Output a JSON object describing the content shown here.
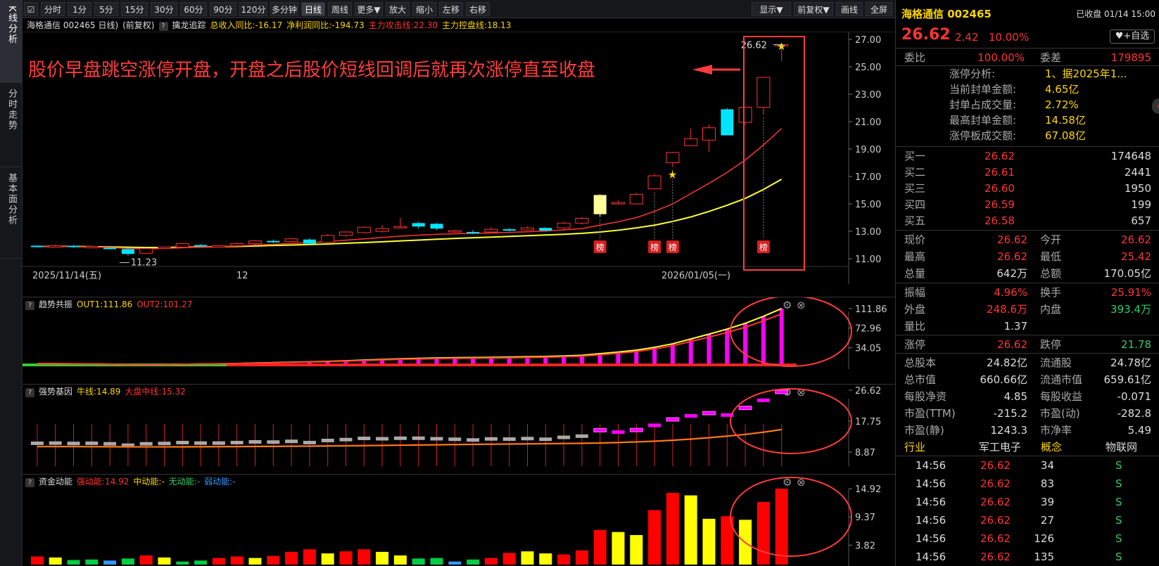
{
  "vtabs": [
    "K线分析",
    "分时走势",
    "基本面分析"
  ],
  "toolbar": {
    "items": [
      "分时",
      "1分",
      "5分",
      "15分",
      "30分",
      "60分",
      "90分",
      "120分",
      "多分钟",
      "日线",
      "周线",
      "更多▼",
      "放大",
      "缩小",
      "左移",
      "右移"
    ],
    "right": [
      "显示▼",
      "前复权▼",
      "画线",
      "全屏"
    ],
    "active": "日线"
  },
  "info": {
    "name": "海格通信 002465 日线)",
    "fq": "(前复权)",
    "q": "?",
    "indicator": "擒龙追踪",
    "rev": "总收入同比:-16.17",
    "profit": "净利润同比:-194.73",
    "attack": "主力攻击线:22.30",
    "control": "主力控盘线:18.13"
  },
  "annotation": "股价早盘跳空涨停开盘，开盘之后股价短线回调后就再次涨停直至收盘",
  "main_chart": {
    "y_ticks": [
      "27.00",
      "25.00",
      "23.00",
      "21.00",
      "19.00",
      "17.00",
      "15.00",
      "13.00",
      "11.00"
    ],
    "dates": [
      "2025/11/14(五)",
      "12",
      "2026/01/05(一)"
    ],
    "low_label": "11.23",
    "high_label": "26.62",
    "bang": "榜",
    "candles": [
      [
        11.95,
        11.9,
        12.0,
        11.85
      ],
      [
        11.92,
        11.95,
        12.05,
        11.85
      ],
      [
        11.95,
        11.85,
        12.0,
        11.8
      ],
      [
        11.9,
        11.9,
        11.95,
        11.8
      ],
      [
        11.8,
        11.75,
        11.85,
        11.7
      ],
      [
        11.7,
        11.35,
        11.75,
        11.23
      ],
      [
        11.4,
        11.75,
        11.8,
        11.35
      ],
      [
        11.75,
        11.85,
        11.9,
        11.7
      ],
      [
        11.85,
        12.1,
        12.15,
        11.8
      ],
      [
        12.0,
        11.95,
        12.05,
        11.9
      ],
      [
        11.9,
        11.95,
        12.0,
        11.85
      ],
      [
        11.95,
        12.1,
        12.2,
        11.9
      ],
      [
        12.1,
        12.3,
        12.35,
        12.0
      ],
      [
        12.3,
        12.25,
        12.4,
        12.15
      ],
      [
        12.25,
        12.45,
        12.5,
        12.2
      ],
      [
        12.4,
        12.1,
        12.5,
        12.05
      ],
      [
        12.2,
        12.7,
        12.8,
        12.15
      ],
      [
        12.7,
        12.95,
        13.0,
        12.6
      ],
      [
        12.9,
        13.3,
        13.35,
        12.85
      ],
      [
        13.0,
        13.2,
        13.45,
        12.9
      ],
      [
        13.3,
        13.35,
        14.0,
        13.2
      ],
      [
        13.6,
        13.35,
        13.7,
        13.2
      ],
      [
        13.55,
        13.2,
        13.6,
        13.1
      ],
      [
        13.0,
        13.05,
        13.1,
        12.9
      ],
      [
        12.95,
        12.85,
        13.1,
        12.8
      ],
      [
        12.95,
        13.15,
        13.3,
        12.9
      ],
      [
        13.15,
        13.1,
        13.25,
        13.0
      ],
      [
        13.1,
        13.25,
        13.35,
        13.05
      ],
      [
        13.25,
        13.05,
        13.3,
        13.0
      ],
      [
        13.25,
        13.6,
        13.7,
        13.15
      ],
      [
        13.6,
        13.95,
        14.05,
        13.5
      ],
      [
        14.25,
        15.65,
        15.7,
        14.05
      ],
      [
        15.1,
        15.1,
        15.25,
        14.95
      ],
      [
        15.0,
        15.7,
        15.8,
        14.95
      ],
      [
        16.1,
        17.05,
        17.2,
        16.05
      ],
      [
        18.0,
        18.75,
        18.8,
        17.7
      ],
      [
        19.25,
        19.75,
        20.5,
        19.2
      ],
      [
        19.65,
        20.55,
        20.8,
        18.8
      ],
      [
        21.9,
        20.0,
        22.0,
        20.0
      ],
      [
        20.95,
        22.05,
        22.1,
        20.75
      ],
      [
        22.05,
        24.23,
        24.23,
        21.5
      ],
      [
        26.62,
        26.62,
        26.62,
        25.42
      ]
    ],
    "ma_red": [
      11.9,
      11.9,
      11.88,
      11.86,
      11.82,
      11.75,
      11.72,
      11.75,
      11.8,
      11.85,
      11.88,
      11.92,
      12.0,
      12.05,
      12.12,
      12.18,
      12.25,
      12.35,
      12.45,
      12.55,
      12.65,
      12.72,
      12.78,
      12.82,
      12.85,
      12.88,
      12.92,
      12.97,
      13.02,
      13.1,
      13.2,
      13.45,
      13.7,
      14.0,
      14.45,
      15.0,
      15.75,
      16.5,
      17.3,
      18.2,
      19.3,
      20.5
    ],
    "ma_yellow": [
      11.9,
      11.9,
      11.9,
      11.88,
      11.86,
      11.84,
      11.82,
      11.82,
      11.84,
      11.86,
      11.88,
      11.9,
      11.93,
      11.97,
      12.0,
      12.04,
      12.08,
      12.13,
      12.18,
      12.24,
      12.3,
      12.36,
      12.42,
      12.48,
      12.53,
      12.58,
      12.63,
      12.68,
      12.73,
      12.78,
      12.85,
      12.95,
      13.08,
      13.25,
      13.45,
      13.72,
      14.05,
      14.45,
      14.9,
      15.4,
      16.05,
      16.8
    ],
    "bang_at": [
      31,
      34,
      35,
      40
    ]
  },
  "sub1": {
    "title": "趋势共振",
    "out1": "OUT1:111.86",
    "out2": "OUT2:101.27",
    "y_ticks": [
      "111.86",
      "72.96",
      "34.05"
    ]
  },
  "sub2": {
    "title": "强势基因",
    "bull": "牛线:14.89",
    "market": "大盘中线:15.32",
    "y_ticks": [
      "26.62",
      "17.75",
      "8.87"
    ]
  },
  "sub3": {
    "title": "资金动能",
    "strong": "强动能:14.92",
    "mid": "中动能:-",
    "none": "无动能:-",
    "weak": "弱动能:-",
    "y_ticks": [
      "14.92",
      "9.37",
      "3.82"
    ],
    "bars": [
      [
        1.6,
        "#ff0000"
      ],
      [
        1.4,
        "#ffff00"
      ],
      [
        0.9,
        "#00cc44"
      ],
      [
        1.0,
        "#00cc44"
      ],
      [
        0.8,
        "#3399ff"
      ],
      [
        1.2,
        "#00cc44"
      ],
      [
        1.8,
        "#ff0000"
      ],
      [
        1.4,
        "#ffff00"
      ],
      [
        0.6,
        "#00cc44"
      ],
      [
        0.8,
        "#00cc44"
      ],
      [
        1.3,
        "#ff0000"
      ],
      [
        1.6,
        "#ff0000"
      ],
      [
        1.3,
        "#ffff00"
      ],
      [
        1.7,
        "#ff0000"
      ],
      [
        2.5,
        "#ff0000"
      ],
      [
        3.0,
        "#ff0000"
      ],
      [
        2.2,
        "#ffff00"
      ],
      [
        2.6,
        "#ff0000"
      ],
      [
        3.0,
        "#ff0000"
      ],
      [
        2.5,
        "#ffff00"
      ],
      [
        1.8,
        "#ffff00"
      ],
      [
        1.2,
        "#00cc44"
      ],
      [
        1.3,
        "#00cc44"
      ],
      [
        0.6,
        "#3399ff"
      ],
      [
        1.0,
        "#00cc44"
      ],
      [
        1.3,
        "#ff0000"
      ],
      [
        2.3,
        "#ff0000"
      ],
      [
        2.6,
        "#ffff00"
      ],
      [
        2.2,
        "#ffff00"
      ],
      [
        2.0,
        "#ff0000"
      ],
      [
        2.8,
        "#ff0000"
      ],
      [
        6.8,
        "#ff0000"
      ],
      [
        6.4,
        "#ffff00"
      ],
      [
        5.8,
        "#ffff00"
      ],
      [
        10.7,
        "#ff0000"
      ],
      [
        14.1,
        "#ff0000"
      ],
      [
        13.6,
        "#ffff00"
      ],
      [
        9.0,
        "#ffff00"
      ],
      [
        9.5,
        "#ff0000"
      ],
      [
        8.8,
        "#ffff00"
      ],
      [
        12.3,
        "#ff0000"
      ],
      [
        14.92,
        "#ff0000"
      ]
    ]
  },
  "panel": {
    "title": "海格通信 002465",
    "status": "已收盘 01/14 15:00",
    "price": "26.62",
    "chg": "2.42",
    "pct": "10.00%",
    "watch": "+自选",
    "wb_label": "委比",
    "wb": "100.00%",
    "wc_label": "委差",
    "wc": "179895",
    "limit_rows": [
      [
        "涨停分析:",
        "1、据2025年1..."
      ],
      [
        "当前封单金额:",
        "4.65亿"
      ],
      [
        "封单占成交量:",
        "2.72%"
      ],
      [
        "最高封单金额:",
        "14.58亿"
      ],
      [
        "涨停板成交额:",
        "67.08亿"
      ]
    ],
    "buys": [
      [
        "买一",
        "26.62",
        "174648"
      ],
      [
        "买二",
        "26.61",
        "2441"
      ],
      [
        "买三",
        "26.60",
        "1950"
      ],
      [
        "买四",
        "26.59",
        "199"
      ],
      [
        "买五",
        "26.58",
        "657"
      ]
    ],
    "quote1": [
      [
        "现价",
        "26.62",
        "今开",
        "26.62"
      ],
      [
        "最高",
        "26.62",
        "最低",
        "25.42"
      ],
      [
        "总量",
        "642万",
        "总额",
        "170.05亿"
      ]
    ],
    "quote2": [
      [
        "振幅",
        "4.96%",
        "换手",
        "25.91%"
      ],
      [
        "外盘",
        "248.6万",
        "内盘",
        "393.4万"
      ],
      [
        "量比",
        "1.37",
        "",
        ""
      ]
    ],
    "limits": [
      "涨停",
      "26.62",
      "跌停",
      "21.78"
    ],
    "fin": [
      [
        "总股本",
        "24.82亿",
        "流通股",
        "24.78亿"
      ],
      [
        "总市值",
        "660.66亿",
        "流通市值",
        "659.61亿"
      ],
      [
        "每股净资",
        "4.85",
        "每股收益",
        "-0.071"
      ],
      [
        "市盈(TTM)",
        "-215.2",
        "市盈(动)",
        "-282.8"
      ],
      [
        "市盈(静)",
        "1243.3",
        "市净率",
        "5.49"
      ]
    ],
    "industry": [
      "行业",
      "军工电子",
      "概念",
      "物联网"
    ],
    "ticks": [
      [
        "14:56",
        "26.62",
        "34",
        "S"
      ],
      [
        "14:56",
        "26.62",
        "83",
        "S"
      ],
      [
        "14:56",
        "26.62",
        "39",
        "S"
      ],
      [
        "14:56",
        "26.62",
        "27",
        "S"
      ],
      [
        "14:56",
        "26.62",
        "126",
        "S"
      ],
      [
        "14:56",
        "26.62",
        "135",
        "S"
      ]
    ],
    "colors": {
      "up": "#ff3333",
      "down": "#33cc66",
      "flat": "#dddddd"
    }
  }
}
